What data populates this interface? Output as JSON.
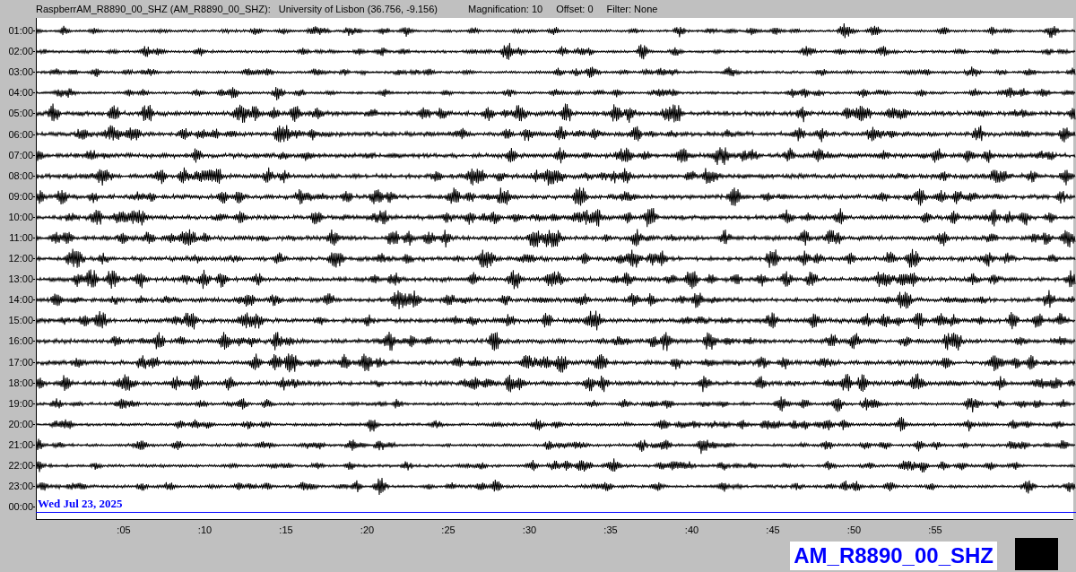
{
  "header": {
    "station": "RaspberrAM_R8890_00_SHZ (AM_R8890_00_SHZ):",
    "location": "University of Lisbon (36.756, -9.156)",
    "magnification": "Magnification: 10",
    "offset": "Offset: 0",
    "filter": "Filter: None"
  },
  "rows": [
    {
      "time": "01:00",
      "kind": "trace"
    },
    {
      "time": "02:00",
      "kind": "trace"
    },
    {
      "time": "03:00",
      "kind": "trace"
    },
    {
      "time": "04:00",
      "kind": "trace"
    },
    {
      "time": "05:00",
      "kind": "trace"
    },
    {
      "time": "06:00",
      "kind": "trace"
    },
    {
      "time": "07:00",
      "kind": "trace"
    },
    {
      "time": "08:00",
      "kind": "trace"
    },
    {
      "time": "09:00",
      "kind": "trace"
    },
    {
      "time": "10:00",
      "kind": "trace"
    },
    {
      "time": "11:00",
      "kind": "trace"
    },
    {
      "time": "12:00",
      "kind": "trace"
    },
    {
      "time": "13:00",
      "kind": "trace"
    },
    {
      "time": "14:00",
      "kind": "trace"
    },
    {
      "time": "15:00",
      "kind": "trace"
    },
    {
      "time": "16:00",
      "kind": "trace"
    },
    {
      "time": "17:00",
      "kind": "trace"
    },
    {
      "time": "18:00",
      "kind": "trace"
    },
    {
      "time": "19:00",
      "kind": "trace"
    },
    {
      "time": "20:00",
      "kind": "trace"
    },
    {
      "time": "21:00",
      "kind": "trace"
    },
    {
      "time": "22:00",
      "kind": "trace"
    },
    {
      "time": "23:00",
      "kind": "trace"
    },
    {
      "time": "00:00",
      "kind": "current",
      "date": "Wed Jul 23, 2025"
    }
  ],
  "x_ticks": [
    ":05",
    ":10",
    ":15",
    ":20",
    ":25",
    ":30",
    ":35",
    ":40",
    ":45",
    ":50",
    ":55"
  ],
  "station_badge": "AM_R8890_00_SHZ"
}
